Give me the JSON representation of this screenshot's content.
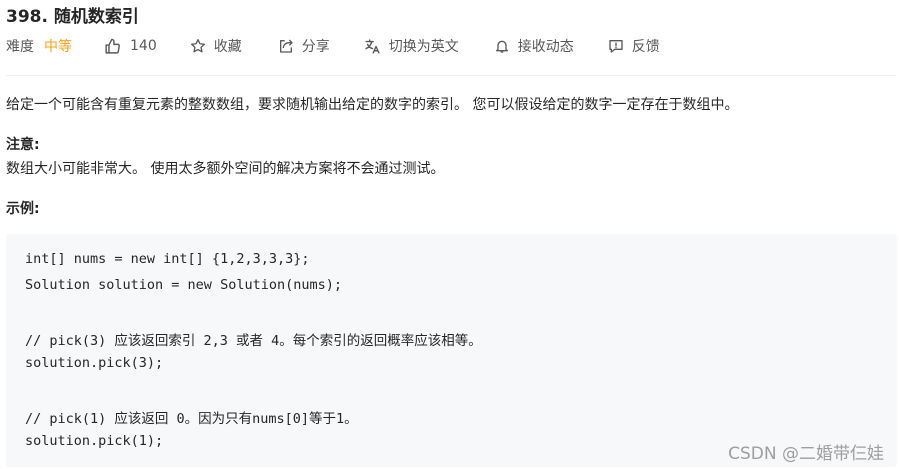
{
  "problem": {
    "title": "398. 随机数索引"
  },
  "toolbar": {
    "difficulty_label": "难度",
    "difficulty_value": "中等",
    "likes_count": "140",
    "favorite_label": "收藏",
    "share_label": "分享",
    "translate_label": "切换为英文",
    "subscribe_label": "接收动态",
    "feedback_label": "反馈",
    "colors": {
      "difficulty_medium": "#ffa116",
      "text_secondary": "#595959"
    }
  },
  "content": {
    "description": "给定一个可能含有重复元素的整数数组，要求随机输出给定的数字的索引。 您可以假设给定的数字一定存在于数组中。",
    "note_heading": "注意:",
    "note_text": "数组大小可能非常大。 使用太多额外空间的解决方案将不会通过测试。",
    "example_heading": "示例:",
    "code_lines": [
      "int[] nums = new int[] {1,2,3,3,3};",
      "Solution solution = new Solution(nums);",
      "",
      "// pick(3) 应该返回索引 2,3 或者 4。每个索引的返回概率应该相等。",
      "solution.pick(3);",
      "",
      "// pick(1) 应该返回 0。因为只有nums[0]等于1。",
      "solution.pick(1);"
    ]
  },
  "watermark": "CSDN @二婚带仨娃"
}
